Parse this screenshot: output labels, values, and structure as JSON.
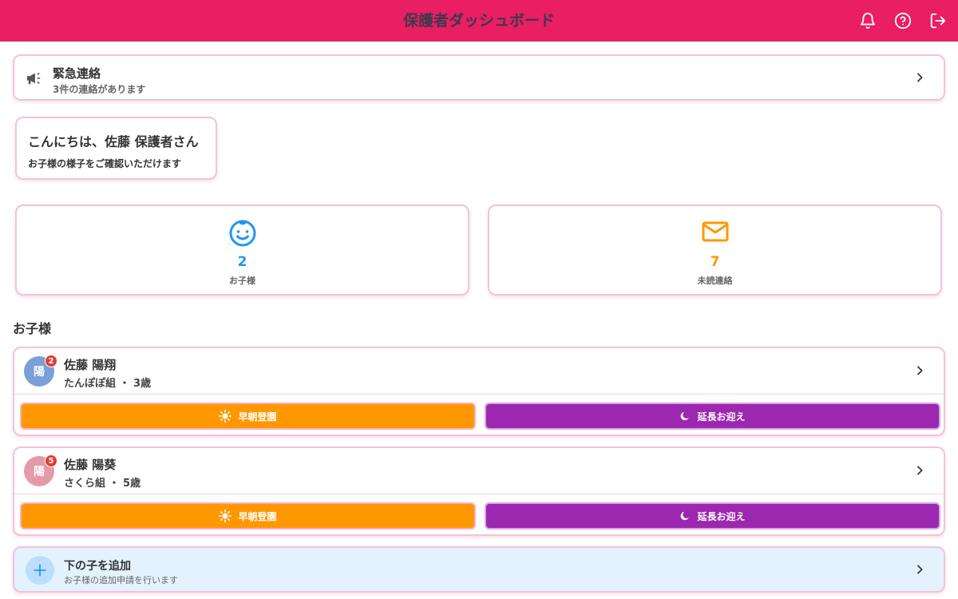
{
  "header": {
    "title": "保護者ダッシュボード"
  },
  "alert": {
    "title": "緊急連絡",
    "subtitle": "3件の連絡があります"
  },
  "greeting": {
    "title": "こんにちは、佐藤 保護者さん",
    "subtitle": "お子様の様子をご確認いただけます"
  },
  "stats": {
    "children": {
      "value": "2",
      "label": "お子様",
      "color": "#2196f3"
    },
    "unread": {
      "value": "7",
      "label": "未読連絡",
      "color": "#ff9800"
    }
  },
  "section": {
    "title": "お子様"
  },
  "children": [
    {
      "initial": "陽",
      "badge": "2",
      "name": "佐藤 陽翔",
      "meta": "たんぽぽ組 ・ 3歳",
      "avatar_color": "#7b9fd8",
      "early_label": "早朝登園",
      "late_label": "延長お迎え"
    },
    {
      "initial": "陽",
      "badge": "5",
      "name": "佐藤 陽葵",
      "meta": "さくら組 ・ 5歳",
      "avatar_color": "#e59aa8",
      "early_label": "早朝登園",
      "late_label": "延長お迎え"
    }
  ],
  "add_child": {
    "title": "下の子を追加",
    "subtitle": "お子様の追加申請を行います"
  },
  "colors": {
    "primary": "#e91e63",
    "orange": "#ff9800",
    "purple": "#9c27b0",
    "blue": "#2196f3"
  }
}
